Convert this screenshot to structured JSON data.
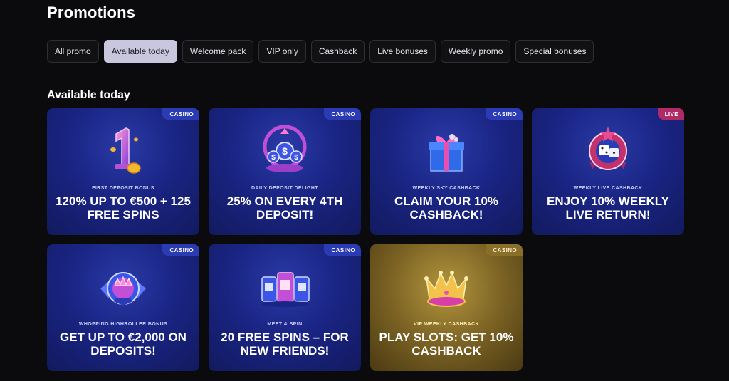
{
  "page": {
    "title": "Promotions"
  },
  "filters": [
    {
      "label": "All promo",
      "active": false
    },
    {
      "label": "Available today",
      "active": true
    },
    {
      "label": "Welcome pack",
      "active": false
    },
    {
      "label": "VIP only",
      "active": false
    },
    {
      "label": "Cashback",
      "active": false
    },
    {
      "label": "Live bonuses",
      "active": false
    },
    {
      "label": "Weekly promo",
      "active": false
    },
    {
      "label": "Special bonuses",
      "active": false
    }
  ],
  "section": {
    "title": "Available today"
  },
  "cards": [
    {
      "badge": "CASINO",
      "badge_type": "casino",
      "icon": "number-one-coin-icon",
      "subtitle": "FIRST DEPOSIT BONUS",
      "headline": "120% UP TO €500 + 125 FREE SPINS"
    },
    {
      "badge": "CASINO",
      "badge_type": "casino",
      "icon": "dollar-chips-icon",
      "subtitle": "DAILY DEPOSIT DELIGHT",
      "headline": "25% ON EVERY 4TH DEPOSIT!"
    },
    {
      "badge": "CASINO",
      "badge_type": "casino",
      "icon": "gift-box-icon",
      "subtitle": "WEEKLY SKY CASHBACK",
      "headline": "CLAIM YOUR 10% CASHBACK!"
    },
    {
      "badge": "LIVE",
      "badge_type": "live",
      "icon": "roulette-dice-icon",
      "subtitle": "WEEKLY LIVE CASHBACK",
      "headline": "ENJOY 10% WEEKLY LIVE RETURN!"
    },
    {
      "badge": "CASINO",
      "badge_type": "casino",
      "icon": "crown-emblem-icon",
      "subtitle": "WHOPPING HIGHROLLER BONUS",
      "headline": "GET UP TO €2,000 ON DEPOSITS!"
    },
    {
      "badge": "CASINO",
      "badge_type": "casino",
      "icon": "slot-machines-icon",
      "subtitle": "MEET & SPIN",
      "headline": "20 FREE SPINS – FOR NEW FRIENDS!"
    },
    {
      "badge": "CASINO",
      "badge_type": "gold",
      "icon": "gold-crown-icon",
      "subtitle": "VIP WEEKLY CASHBACK",
      "headline": "PLAY SLOTS: GET 10% CASHBACK"
    }
  ],
  "colors": {
    "background": "#0b0b0d",
    "card_blue": "#1a2585",
    "card_gold": "#7c6324",
    "badge_casino": "#2b3bb4",
    "badge_live": "#b02a66",
    "chip_active": "#c9c7dd"
  }
}
